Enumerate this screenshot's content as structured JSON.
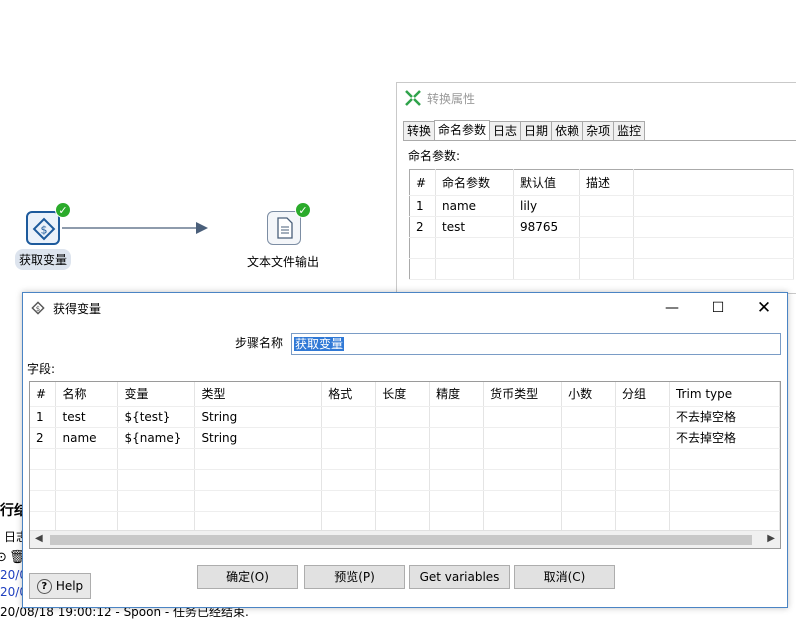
{
  "canvas": {
    "step1": {
      "label": "获取变量",
      "icon": "get-variables-icon",
      "status_icon": "check-icon"
    },
    "step2": {
      "label": "文本文件输出",
      "icon": "text-file-output-icon",
      "status_icon": "check-icon"
    }
  },
  "trans_props": {
    "title": "转换属性",
    "tabs": [
      "转换",
      "命名参数",
      "日志",
      "日期",
      "依赖",
      "杂项",
      "监控"
    ],
    "caption": "命名参数:",
    "columns": [
      "#",
      "命名参数",
      "默认值",
      "描述"
    ],
    "rows": [
      [
        "1",
        "name",
        "lily",
        ""
      ],
      [
        "2",
        "test",
        "98765",
        ""
      ]
    ]
  },
  "log_fragments": {
    "header": "行结",
    "tab": "日志",
    "line1": "20/0",
    "line2": "20/0",
    "line3": "20/08/18 19:00:12 - Spoon - 任务已经结束."
  },
  "dialog": {
    "title": "获得变量",
    "step_name_label": "步骤名称",
    "step_name_value": "获取变量",
    "fields_label": "字段:",
    "columns": [
      "#",
      "名称",
      "变量",
      "类型",
      "格式",
      "长度",
      "精度",
      "货币类型",
      "小数",
      "分组",
      "Trim type"
    ],
    "rows": [
      [
        "1",
        "test",
        "${test}",
        "String",
        "",
        "",
        "",
        "",
        "",
        "",
        "不去掉空格"
      ],
      [
        "2",
        "name",
        "${name}",
        "String",
        "",
        "",
        "",
        "",
        "",
        "",
        "不去掉空格"
      ]
    ],
    "buttons": {
      "ok": "确定(O)",
      "preview": "预览(P)",
      "get_variables": "Get variables",
      "cancel": "取消(C)",
      "help": "Help"
    }
  }
}
